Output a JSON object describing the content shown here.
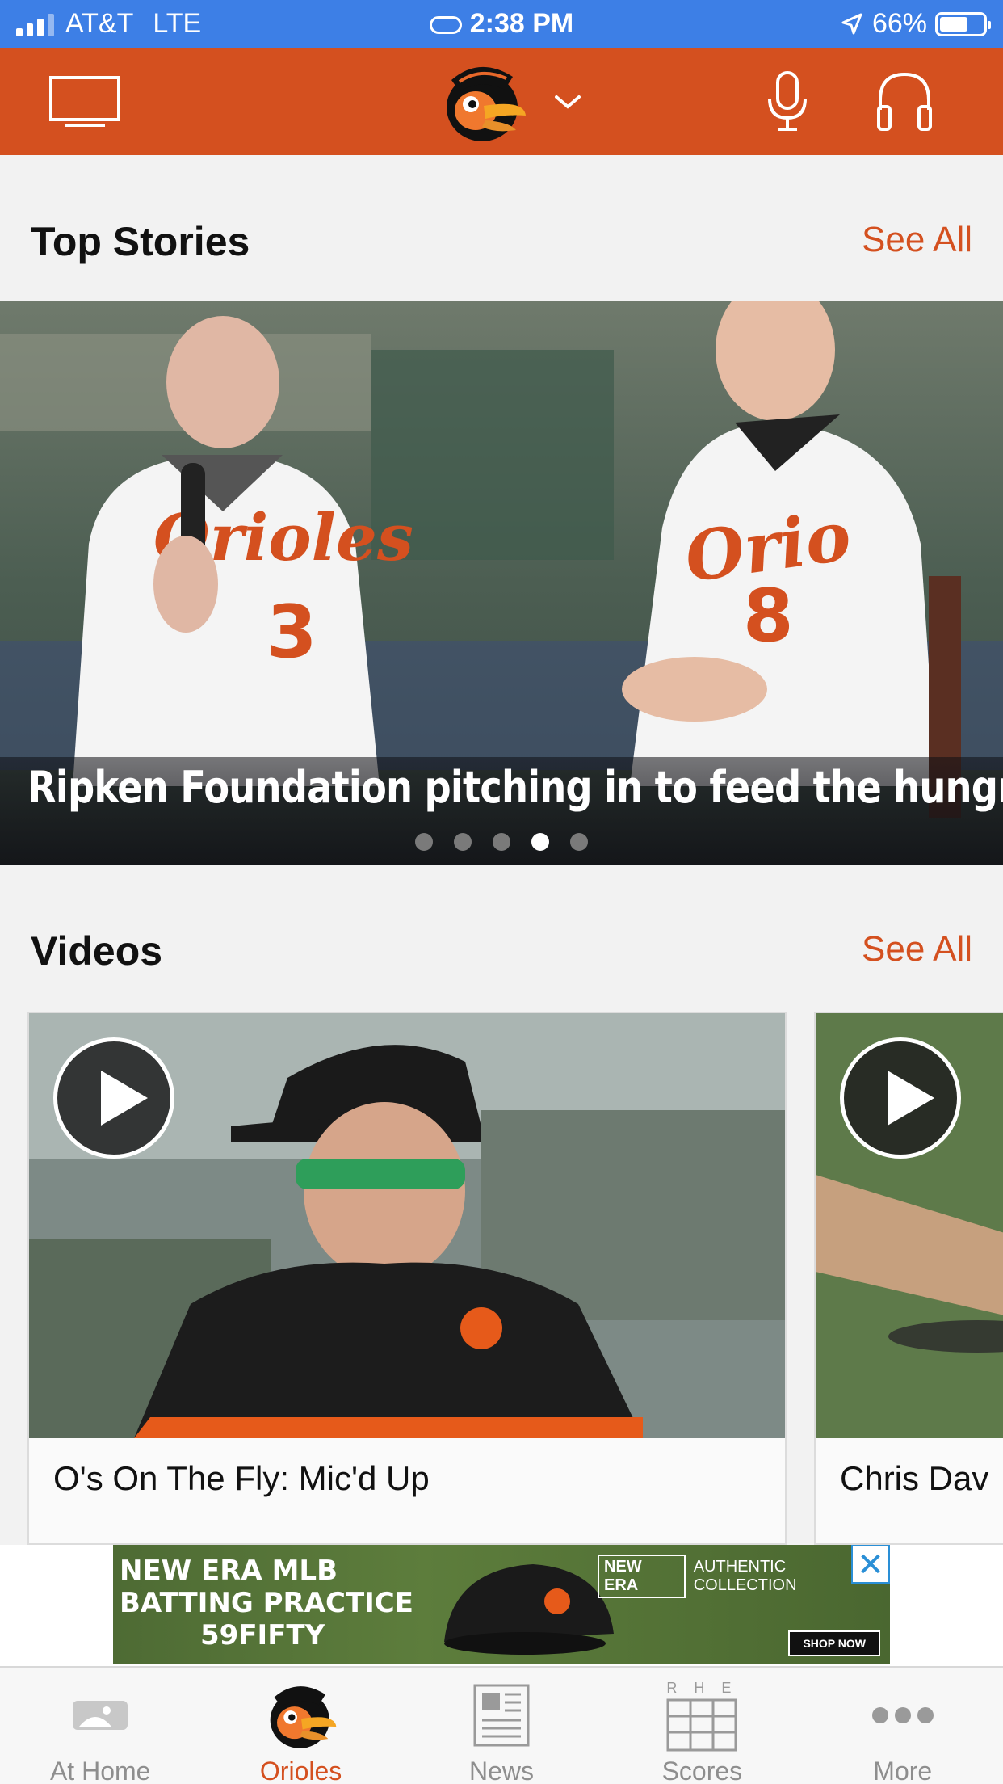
{
  "status_bar": {
    "carrier": "AT&T",
    "network": "LTE",
    "time": "2:38 PM",
    "battery": "66%",
    "battery_level": 0.66
  },
  "header": {
    "icons": [
      "tv-icon",
      "orioles-logo",
      "chevron-down-icon",
      "microphone-icon",
      "headphones-icon"
    ]
  },
  "top_stories": {
    "title": "Top Stories",
    "see_all": "See All",
    "headline": "Ripken Foundation pitching in to feed the hungry",
    "page_count": 5,
    "active_page": 4
  },
  "videos": {
    "title": "Videos",
    "see_all": "See All",
    "items": [
      {
        "title": "O's On The Fly: Mic'd Up"
      },
      {
        "title": "Chris Dav"
      }
    ]
  },
  "ad": {
    "line1": "NEW ERA MLB",
    "line2": "BATTING PRACTICE",
    "line3": "59FIFTY",
    "brand1": "NEW ERA",
    "brand2": "AUTHENTIC COLLECTION",
    "cta": "SHOP NOW",
    "close": "✕"
  },
  "tabs": [
    {
      "label": "At Home",
      "icon": "mlb-logo-icon",
      "active": false
    },
    {
      "label": "Orioles",
      "icon": "orioles-logo-icon",
      "active": true
    },
    {
      "label": "News",
      "icon": "newspaper-icon",
      "active": false
    },
    {
      "label": "Scores",
      "icon": "scoreboard-icon",
      "active": false,
      "header": "R H E"
    },
    {
      "label": "More",
      "icon": "more-dots-icon",
      "active": false
    }
  ],
  "colors": {
    "accent": "#d4501f",
    "status_bar": "#3d7fe6",
    "tab_inactive": "#8e8e8e"
  }
}
